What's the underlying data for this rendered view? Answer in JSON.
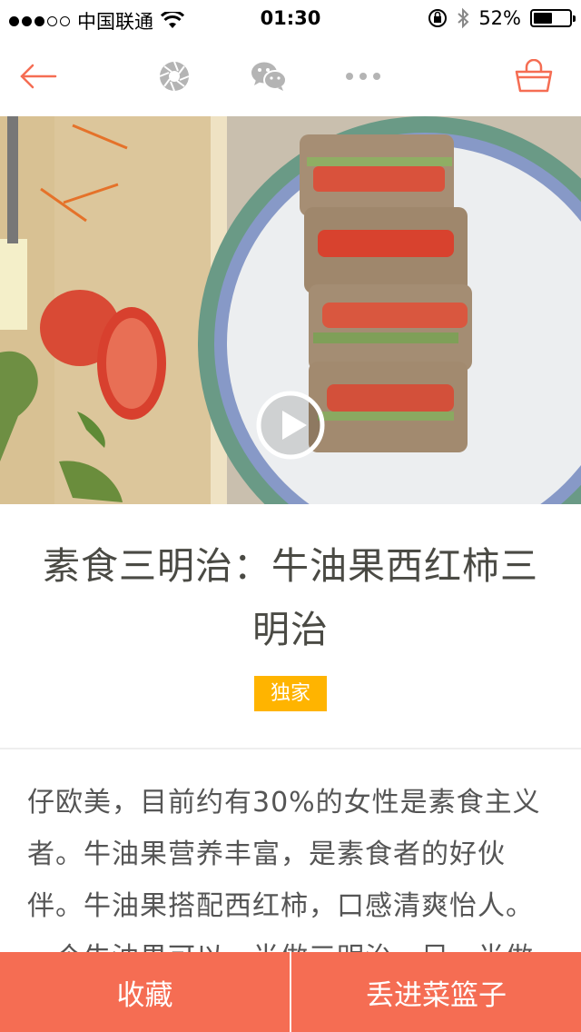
{
  "status_bar": {
    "carrier": "中国联通",
    "time": "01:30",
    "battery": "52%",
    "battery_level": 0.52
  },
  "nav": {
    "icons": [
      "back-arrow-icon",
      "camera-aperture-icon",
      "wechat-icon",
      "more-dots-icon",
      "basket-icon"
    ],
    "accent": "#f56d53",
    "icon_gray": "#b4b4b4"
  },
  "hero": {
    "play_icon": "play-icon"
  },
  "recipe": {
    "title": "素食三明治：牛油果西红柿三明治",
    "tag": "独家",
    "tag_color": "#ffb400",
    "description": "仔欧美，目前约有30%的女性是素食主义者。牛油果营养丰富，是素食者的好伙伴。牛油果搭配西红柿，口感清爽怡人。一个牛油果可以一半做三明治，另一半做"
  },
  "actions": {
    "favorite": "收藏",
    "add_to_basket": "丢进菜篮子",
    "bar_color": "#f56d53"
  }
}
